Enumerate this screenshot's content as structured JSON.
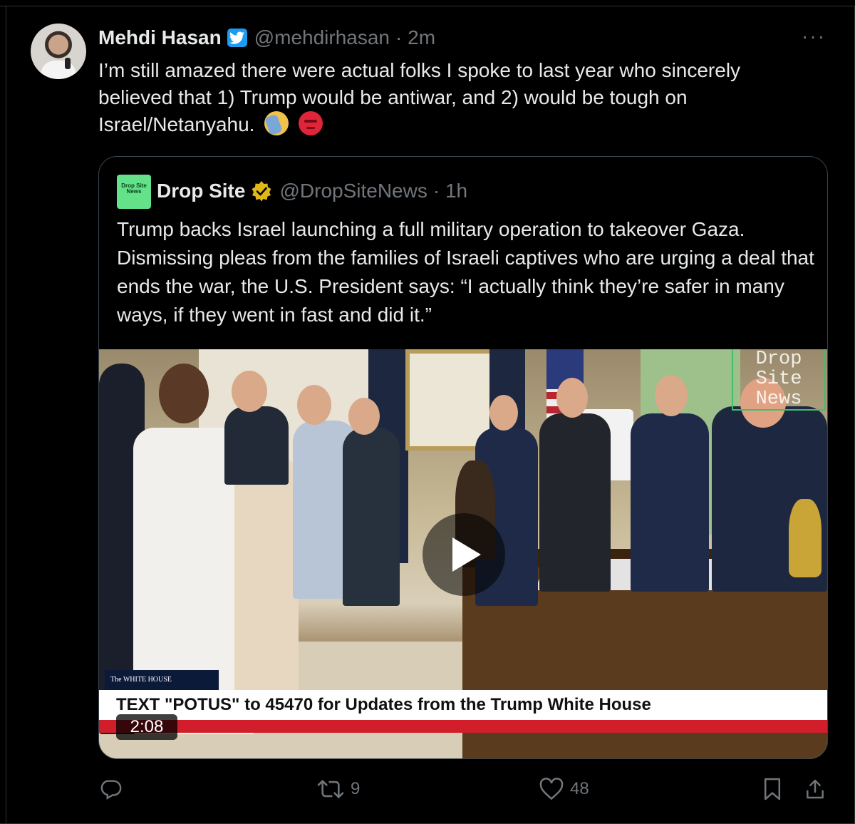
{
  "tweet": {
    "author_name": "Mehdi Hasan",
    "handle": "@mehdirhasan",
    "time": "· 2m",
    "more": "···",
    "text": "I’m still amazed there were actual folks I spoke to last year who sincerely believed that 1) Trump would be antiwar, and 2) would be tough on Israel/Netanyahu."
  },
  "quoted": {
    "avatar_text": "Drop Site News",
    "author_name": "Drop Site",
    "handle": "@DropSiteNews",
    "time": "· 1h",
    "text": "Trump backs Israel launching a full military operation to takeover Gaza. Dismissing pleas from the families of Israeli captives who are urging a deal that ends the war, the U.S. President says: “I actually think they’re safer in many ways, if they went in fast and did it.”",
    "video": {
      "watermark": [
        "Drop",
        "Site",
        "News"
      ],
      "logo_text": "The WHITE HOUSE",
      "banner": "TEXT \"POTUS\" to 45470 for Updates from the Trump White House",
      "duration": "2:08"
    }
  },
  "actions": {
    "reply_count": "",
    "retweet_count": "9",
    "like_count": "48"
  },
  "colors": {
    "background": "#000000",
    "text": "#e7e9ea",
    "muted": "#71767b",
    "verified_blue": "#1d9bf0",
    "gold_badge": "#e2b719",
    "banner_red": "#d21e2b"
  },
  "icons": [
    "verified-icon",
    "gold-verified-icon",
    "facepalm-emoji",
    "angry-emoji",
    "play-icon",
    "reply-icon",
    "retweet-icon",
    "like-icon",
    "bookmark-icon",
    "share-icon",
    "more-icon"
  ]
}
